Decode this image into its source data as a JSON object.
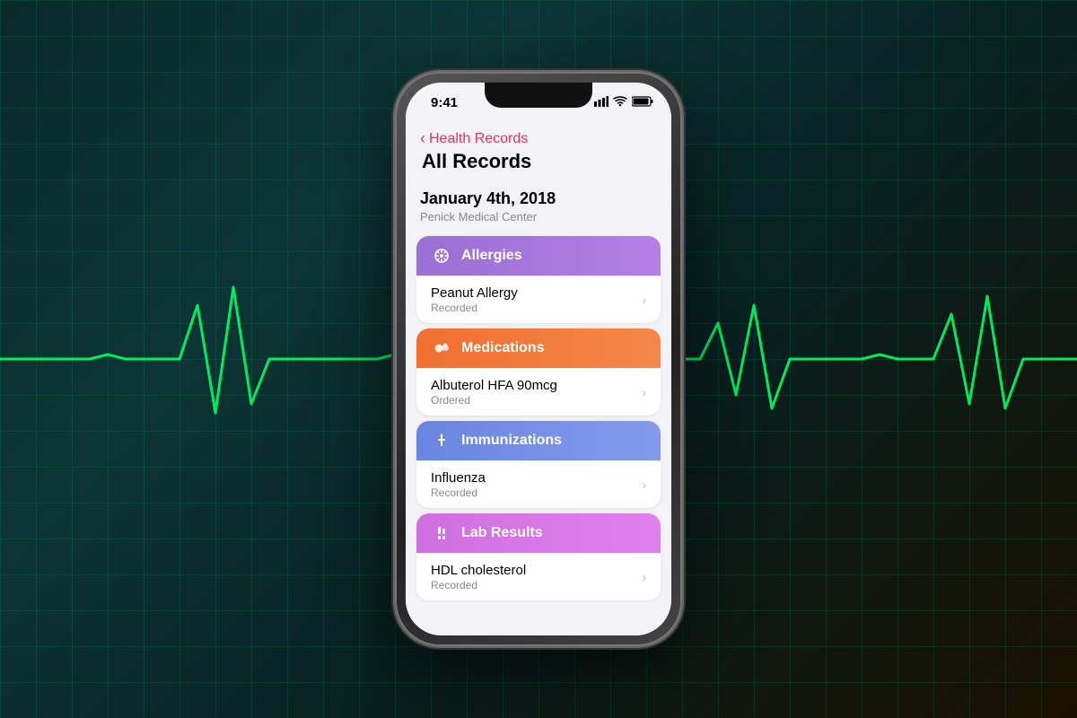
{
  "background": {
    "gradient_desc": "dark teal ECG background"
  },
  "status_bar": {
    "time": "9:41",
    "signal_icon": "📶",
    "wifi_icon": "wifi",
    "battery_icon": "battery"
  },
  "navigation": {
    "back_label": "Health Records",
    "title": "All Records"
  },
  "record_header": {
    "date": "January 4th, 2018",
    "facility": "Penick Medical Center"
  },
  "sections": [
    {
      "id": "allergies",
      "title": "Allergies",
      "icon": "✳",
      "color_class": "allergies",
      "items": [
        {
          "name": "Peanut Allergy",
          "status": "Recorded"
        }
      ]
    },
    {
      "id": "medications",
      "title": "Medications",
      "icon": "💊",
      "color_class": "medications",
      "items": [
        {
          "name": "Albuterol HFA 90mcg",
          "status": "Ordered"
        }
      ]
    },
    {
      "id": "immunizations",
      "title": "Immunizations",
      "icon": "💉",
      "color_class": "immunizations",
      "items": [
        {
          "name": "Influenza",
          "status": "Recorded"
        }
      ]
    },
    {
      "id": "lab-results",
      "title": "Lab Results",
      "icon": "🧪",
      "color_class": "lab-results",
      "items": [
        {
          "name": "HDL cholesterol",
          "status": "Recorded"
        }
      ]
    }
  ]
}
